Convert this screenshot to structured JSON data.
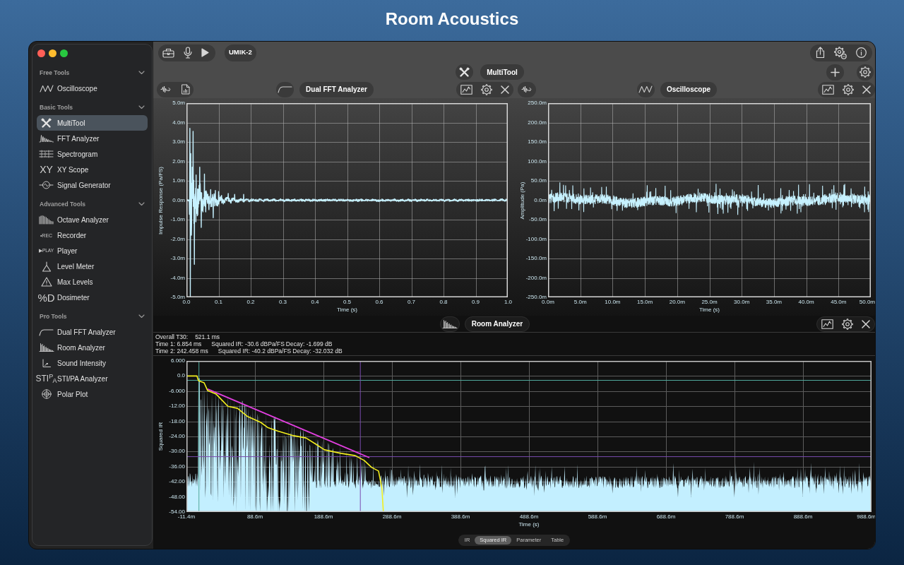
{
  "page_title": "Room Acoustics",
  "sidebar": {
    "sections": [
      {
        "title": "Free Tools",
        "expanded": true,
        "items": [
          {
            "label": "Oscilloscope",
            "kind": "oscilloscope",
            "selected": false
          }
        ]
      },
      {
        "title": "Basic Tools",
        "expanded": true,
        "items": [
          {
            "label": "MultiTool",
            "kind": "multitool",
            "selected": true
          },
          {
            "label": "FFT Analyzer",
            "kind": "fft",
            "selected": false
          },
          {
            "label": "Spectrogram",
            "kind": "spectrogram",
            "selected": false
          },
          {
            "label": "XY Scope",
            "kind": "xyscope",
            "glyph": "XY",
            "selected": false
          },
          {
            "label": "Signal Generator",
            "kind": "generator",
            "selected": false
          }
        ]
      },
      {
        "title": "Advanced Tools",
        "expanded": true,
        "items": [
          {
            "label": "Octave Analyzer",
            "kind": "octave",
            "selected": false
          },
          {
            "label": "Recorder",
            "kind": "recorder",
            "glyph": "•REC",
            "selected": false
          },
          {
            "label": "Player",
            "kind": "player",
            "glyph": "▶PLAY",
            "selected": false
          },
          {
            "label": "Level Meter",
            "kind": "levelmeter",
            "selected": false
          },
          {
            "label": "Max Levels",
            "kind": "maxlevels",
            "selected": false
          },
          {
            "label": "Dosimeter",
            "kind": "dosimeter",
            "glyph": "%D",
            "selected": false
          }
        ]
      },
      {
        "title": "Pro Tools",
        "expanded": true,
        "items": [
          {
            "label": "Dual FFT Analyzer",
            "kind": "dualfft",
            "selected": false
          },
          {
            "label": "Room Analyzer",
            "kind": "room",
            "selected": false
          },
          {
            "label": "Sound Intensity",
            "kind": "intensity",
            "selected": false
          },
          {
            "label": "STI/PA Analyzer",
            "kind": "stipa",
            "glyph": "STI$^{P}$$_{A}$",
            "selected": false
          },
          {
            "label": "Polar Plot",
            "kind": "polar",
            "selected": false
          }
        ]
      }
    ]
  },
  "toolbar": {
    "device": "UMIK-2"
  },
  "workspace": {
    "title": "MultiTool",
    "kind": "multitool"
  },
  "panels": [
    {
      "title": "Dual FFT Analyzer",
      "kind": "dualfft",
      "plot": {
        "kind": "impulse",
        "ylabel": "Impulse Response (Pa/FS)",
        "xlabel": "Time (s)",
        "yticks": [
          "5.0m",
          "4.0m",
          "3.0m",
          "2.0m",
          "1.0m",
          "0.0m",
          "-1.0m",
          "-2.0m",
          "-3.0m",
          "-4.0m",
          "-5.0m"
        ],
        "xticks": [
          "0.0",
          "0.1",
          "0.2",
          "0.3",
          "0.4",
          "0.5",
          "0.6",
          "0.7",
          "0.8",
          "0.9",
          "1.0"
        ]
      }
    },
    {
      "title": "Oscilloscope",
      "kind": "oscilloscope",
      "plot": {
        "kind": "noise",
        "ylabel": "Amplitude (Pa)",
        "xlabel": "Time (s)",
        "yticks": [
          "250.0m",
          "200.0m",
          "150.0m",
          "100.0m",
          "50.0m",
          "0.0m",
          "-50.0m",
          "-100.0m",
          "-150.0m",
          "-200.0m",
          "-250.0m"
        ],
        "xticks": [
          "0.0m",
          "5.0m",
          "10.0m",
          "15.0m",
          "20.0m",
          "25.0m",
          "30.0m",
          "35.0m",
          "40.0m",
          "45.0m",
          "50.0m"
        ]
      }
    }
  ],
  "room_analyzer": {
    "title": "Room Analyzer",
    "kind": "room",
    "overall": {
      "label": "Overall T30:",
      "value": "521.1 ms"
    },
    "cursors": [
      {
        "time": "Time 1: 6.854 ms",
        "squared_ir": "Squared IR: -30.6 dBPa/FS",
        "decay": "Decay: -1.699 dB"
      },
      {
        "time": "Time 2: 242.458 ms",
        "squared_ir": "Squared IR: -40.2 dBPa/FS",
        "decay": "Decay: -32.032 dB"
      }
    ],
    "plot": {
      "kind": "decay",
      "ylabel": "Squared IR",
      "xlabel": "Time (s)",
      "yticks": [
        "6.000",
        "0.0",
        "-6.000",
        "-12.00",
        "-18.00",
        "-24.00",
        "-30.00",
        "-36.00",
        "-42.00",
        "-48.00",
        "-54.00"
      ],
      "xticks": [
        "-11.4m",
        "88.6m",
        "188.6m",
        "288.6m",
        "388.6m",
        "488.6m",
        "588.6m",
        "688.6m",
        "788.6m",
        "888.6m",
        "988.6m"
      ]
    },
    "tabs": [
      {
        "label": "IR",
        "selected": false
      },
      {
        "label": "Squared IR",
        "selected": true
      },
      {
        "label": "Parameter",
        "selected": false
      },
      {
        "label": "Table",
        "selected": false
      }
    ]
  }
}
